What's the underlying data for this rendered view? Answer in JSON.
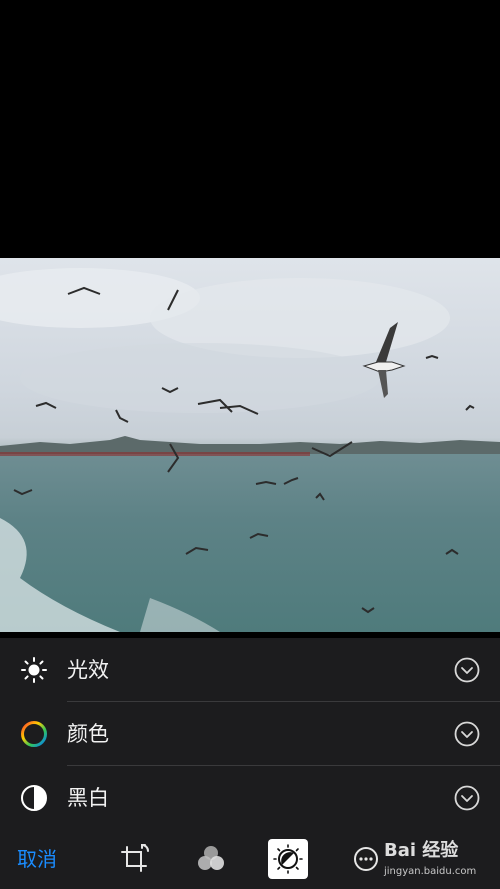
{
  "adjustments": {
    "items": [
      {
        "label": "光效",
        "icon": "sun-icon"
      },
      {
        "label": "颜色",
        "icon": "color-wheel-icon"
      },
      {
        "label": "黑白",
        "icon": "half-circle-icon"
      }
    ]
  },
  "toolbar": {
    "cancel_label": "取消",
    "tools": [
      "crop-icon",
      "filters-icon",
      "adjust-icon",
      "more-icon"
    ]
  },
  "watermark": {
    "text": "Bai 经验",
    "sub": "jingyan.baidu.com"
  },
  "colors": {
    "accent": "#1a8cff",
    "panel": "#1c1c1e",
    "separator": "#3a3a3c"
  }
}
